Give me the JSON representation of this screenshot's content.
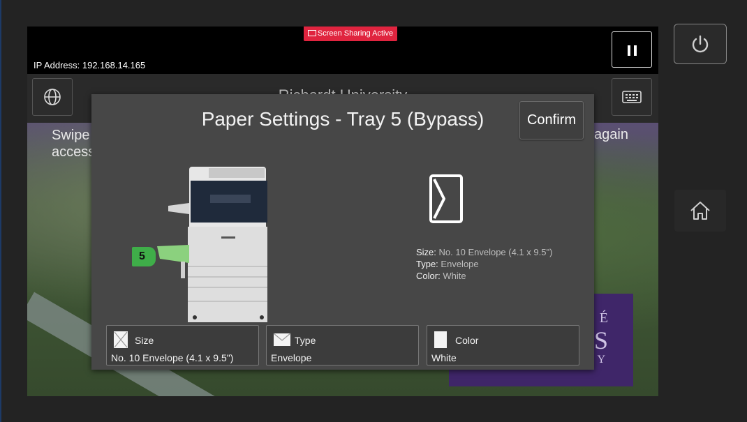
{
  "banner": {
    "screen_sharing": "Screen Sharing Active"
  },
  "device": {
    "ip_address": "IP Address: 192.168.14.165"
  },
  "background": {
    "university": "Richardt University",
    "swipe_line1": "Swipe",
    "swipe_line2": "access",
    "again": "again",
    "sign_line1": "É",
    "sign_line2": "S",
    "sign_line3": "Y"
  },
  "dialog": {
    "title": "Paper Settings - Tray 5 (Bypass)",
    "confirm_label": "Confirm",
    "tray_number": "5",
    "info": {
      "size_label": "Size:",
      "size_value": "No. 10 Envelope (4.1 x 9.5\")",
      "type_label": "Type:",
      "type_value": "Envelope",
      "color_label": "Color:",
      "color_value": "White"
    },
    "tiles": [
      {
        "label": "Size",
        "value": "No. 10 Envelope (4.1 x 9.5\")",
        "icon": "envelope-size-icon"
      },
      {
        "label": "Type",
        "value": "Envelope",
        "icon": "envelope-icon"
      },
      {
        "label": "Color",
        "value": "White",
        "icon": "paper-color-icon"
      }
    ]
  },
  "colors": {
    "banner": "#e0243f",
    "dialog": "#474747",
    "tray_badge": "#3fae49",
    "sign": "#3f2669"
  }
}
